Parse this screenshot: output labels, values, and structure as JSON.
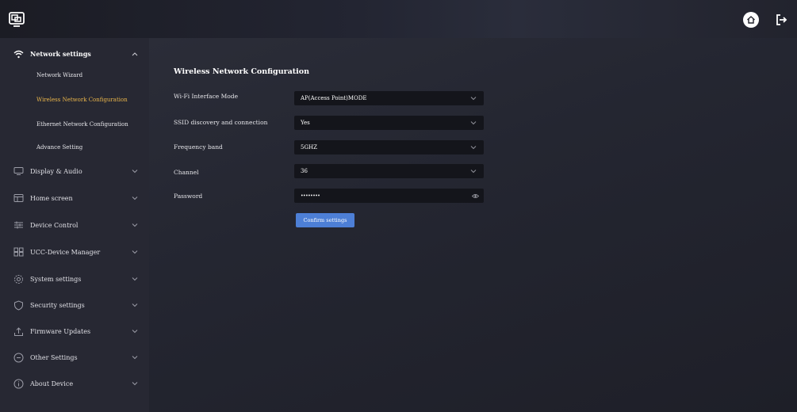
{
  "header": {
    "logo_icon": "screen-share-icon",
    "home_icon": "home-icon",
    "logout_icon": "logout-icon"
  },
  "sidebar": {
    "groups": [
      {
        "label": "Network settings",
        "icon": "wifi-icon",
        "expanded": true,
        "subitems": [
          {
            "label": "Network Wizard",
            "active": false
          },
          {
            "label": "Wireless Network Configuration",
            "active": true
          },
          {
            "label": "Ethernet Network Configuration",
            "active": false
          },
          {
            "label": "Advance Setting",
            "active": false
          }
        ]
      },
      {
        "label": "Display & Audio",
        "icon": "monitor-icon",
        "expanded": false
      },
      {
        "label": "Home screen",
        "icon": "home-screen-icon",
        "expanded": false
      },
      {
        "label": "Device Control",
        "icon": "sliders-icon",
        "expanded": false
      },
      {
        "label": "UCC-Device Manager",
        "icon": "grid-icon",
        "expanded": false
      },
      {
        "label": "System settings",
        "icon": "gear-icon",
        "expanded": false
      },
      {
        "label": "Security settings",
        "icon": "shield-icon",
        "expanded": false
      },
      {
        "label": "Firmware Updates",
        "icon": "upload-icon",
        "expanded": false
      },
      {
        "label": "Other Settings",
        "icon": "more-icon",
        "expanded": false
      },
      {
        "label": "About Device",
        "icon": "info-icon",
        "expanded": false
      }
    ]
  },
  "main": {
    "title": "Wireless Network Configuration",
    "fields": [
      {
        "label": "Wi-Fi Interface Mode",
        "value": "AP(Access Point)MODE",
        "type": "select"
      },
      {
        "label": "SSID discovery and connection",
        "value": "Yes",
        "type": "select"
      },
      {
        "label": "Frequency band",
        "value": "5GHZ",
        "type": "select"
      },
      {
        "label": "Channel",
        "value": "36",
        "type": "select"
      },
      {
        "label": "Password",
        "value": "••••••••",
        "type": "password"
      }
    ],
    "confirm_label": "Confirm settings"
  },
  "colors": {
    "accent": "#4d7fd6",
    "active_item": "#e9b54a",
    "sidebar_bg": "#272833",
    "field_bg": "#14151b"
  }
}
